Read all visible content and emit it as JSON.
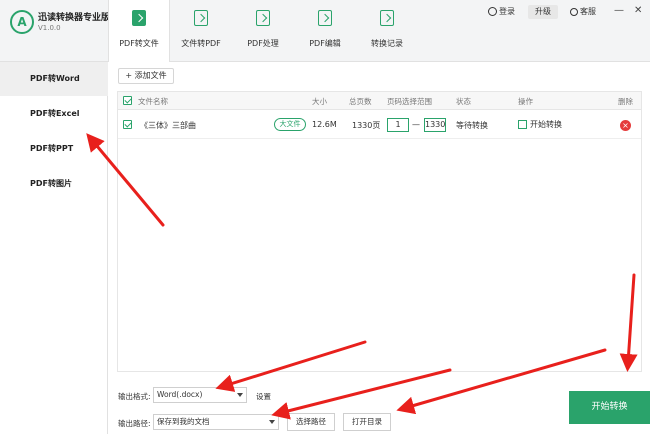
{
  "app": {
    "logo_letter": "A",
    "title": "迅读转换器专业版",
    "version": "V1.0.0"
  },
  "top_right": {
    "login": "登录",
    "upgrade": "升级",
    "service": "客服",
    "minimize": "—",
    "close": "✕"
  },
  "nav_tabs": [
    {
      "label": "PDF转文件"
    },
    {
      "label": "文件转PDF"
    },
    {
      "label": "PDF处理"
    },
    {
      "label": "PDF编辑"
    },
    {
      "label": "转换记录"
    }
  ],
  "sidebar": {
    "items": [
      {
        "label": "PDF转Word"
      },
      {
        "label": "PDF转Excel"
      },
      {
        "label": "PDF转PPT"
      },
      {
        "label": "PDF转图片"
      }
    ]
  },
  "toolbar": {
    "add_file": "+ 添加文件"
  },
  "table": {
    "headers": {
      "name": "文件名称",
      "size": "大小",
      "pages": "总页数",
      "range": "页码选择范围",
      "status": "状态",
      "action": "操作",
      "delete": "删除"
    },
    "rows": [
      {
        "name": "《三体》三部曲",
        "tag": "大文件",
        "size": "12.6M",
        "pages": "1330页",
        "from": "1",
        "dash": "—",
        "to": "1330",
        "status": "等待转换",
        "action": "开始转换",
        "delete": "×"
      }
    ]
  },
  "options": {
    "format_label": "输出格式:",
    "format_value": "Word(.docx)",
    "settings": "设置",
    "path_label": "输出路径:",
    "path_value": "保存到我的文档",
    "choose_path": "选择路径",
    "open_dir": "打开目录"
  },
  "start_button": "开始转换",
  "colors": {
    "accent": "#2aa36b",
    "arrow": "#e8201c",
    "delete": "#e53c3c"
  }
}
